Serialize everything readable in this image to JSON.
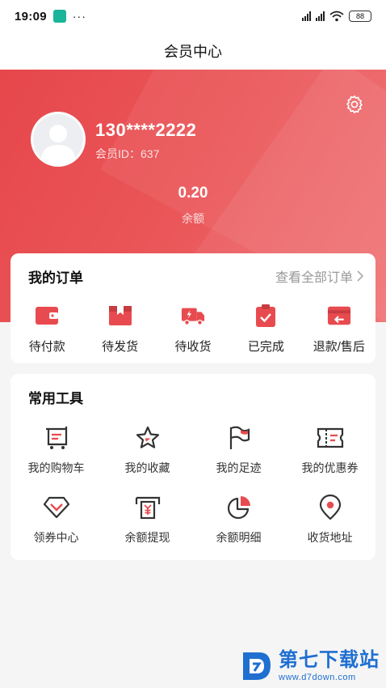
{
  "status_bar": {
    "time": "19:09",
    "dots": "···",
    "battery": "88"
  },
  "header": {
    "title": "会员中心",
    "username": "130****2222",
    "member_id": "会员ID：637",
    "balance": "0.20",
    "balance_label": "余额"
  },
  "orders": {
    "title": "我的订单",
    "view_all": "查看全部订单",
    "items": [
      {
        "label": "待付款",
        "icon": "wallet-icon"
      },
      {
        "label": "待发货",
        "icon": "box-icon"
      },
      {
        "label": "待收货",
        "icon": "truck-icon"
      },
      {
        "label": "已完成",
        "icon": "clipboard-check-icon"
      },
      {
        "label": "退款/售后",
        "icon": "refund-icon"
      }
    ]
  },
  "tools": {
    "title": "常用工具",
    "items": [
      {
        "label": "我的购物车",
        "icon": "cart-icon"
      },
      {
        "label": "我的收藏",
        "icon": "star-icon"
      },
      {
        "label": "我的足迹",
        "icon": "flag-icon"
      },
      {
        "label": "我的优惠券",
        "icon": "ticket-icon"
      },
      {
        "label": "领券中心",
        "icon": "diamond-icon"
      },
      {
        "label": "余额提现",
        "icon": "withdraw-icon"
      },
      {
        "label": "余额明细",
        "icon": "pie-icon"
      },
      {
        "label": "收货地址",
        "icon": "location-icon"
      }
    ]
  },
  "watermark": {
    "title": "第七下载站",
    "url": "www.d7down.com"
  },
  "colors": {
    "brand_red": "#e84b4f",
    "icon_dark": "#333333",
    "watermark_blue": "#1f6fd1"
  }
}
